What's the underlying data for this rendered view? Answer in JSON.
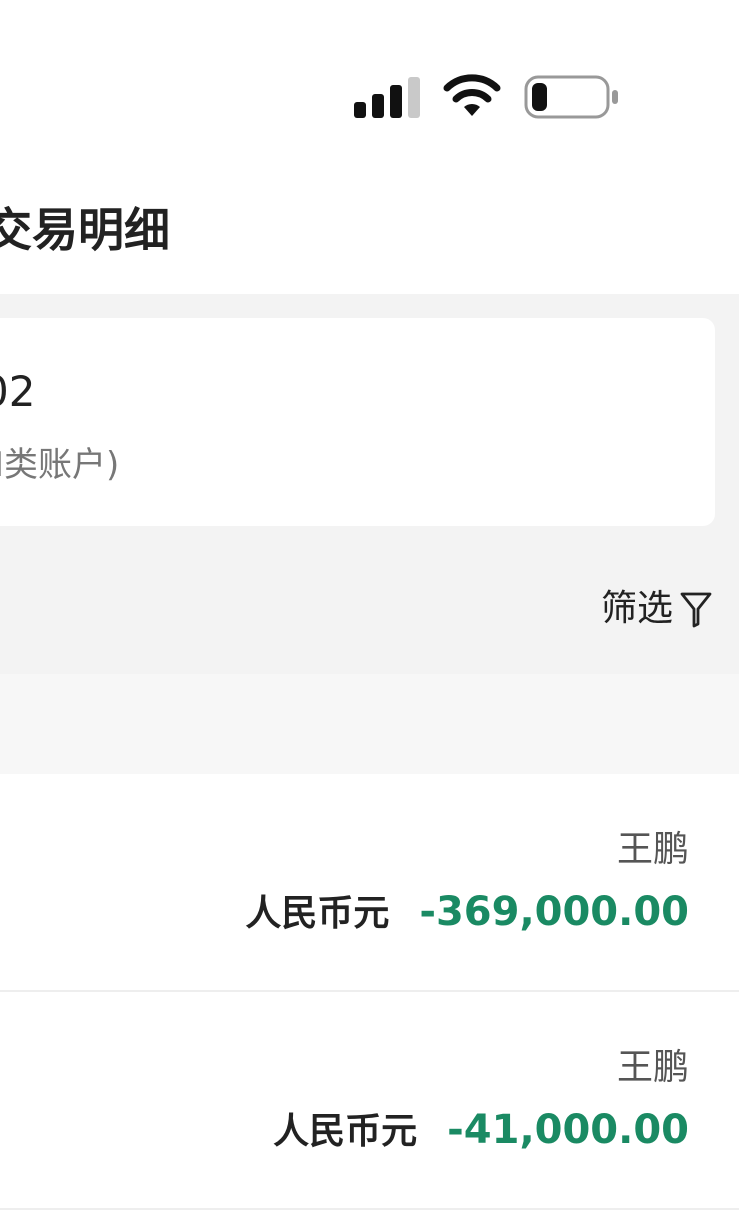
{
  "header": {
    "title": "交易明细"
  },
  "account": {
    "number_tail": "02",
    "type_fragment": "I类账户)"
  },
  "filter": {
    "label": "筛选",
    "icon": "filter-icon"
  },
  "transactions": [
    {
      "counterparty": "王鹏",
      "currency": "人民币元",
      "amount": "-369,000.00"
    },
    {
      "counterparty": "王鹏",
      "currency": "人民币元",
      "amount": "-41,000.00"
    }
  ],
  "colors": {
    "amount_negative": "#1a8a63",
    "background_gray": "#f3f3f3"
  },
  "status_bar": {
    "icons": [
      "cellular-signal-icon",
      "wifi-icon",
      "battery-icon"
    ]
  }
}
